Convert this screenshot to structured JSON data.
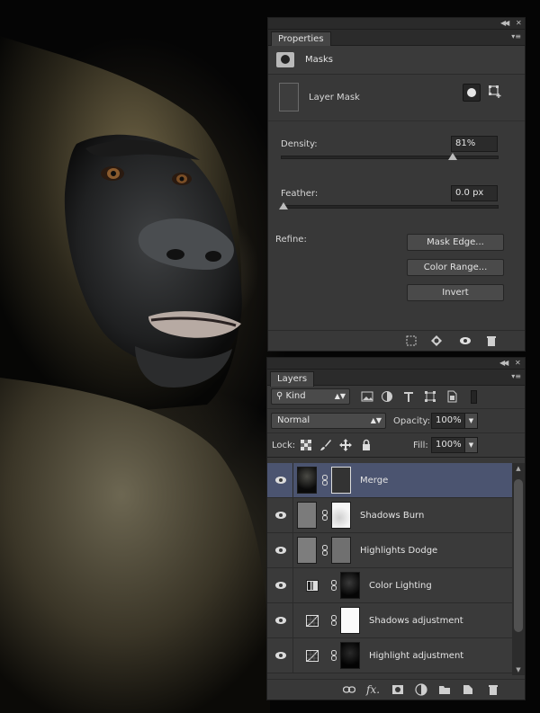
{
  "properties_panel": {
    "tab_label": "Properties",
    "section_title": "Masks",
    "layer_mask_label": "Layer Mask",
    "density": {
      "label": "Density:",
      "value": "81%",
      "percent": 81
    },
    "feather": {
      "label": "Feather:",
      "value": "0.0 px",
      "percent": 0
    },
    "refine_label": "Refine:",
    "buttons": {
      "mask_edge": "Mask Edge...",
      "color_range": "Color Range...",
      "invert": "Invert"
    }
  },
  "layers_panel": {
    "tab_label": "Layers",
    "filter": {
      "kind_label": "Kind"
    },
    "blend_mode": "Normal",
    "opacity": {
      "label": "Opacity:",
      "value": "100%"
    },
    "lock_label": "Lock:",
    "fill": {
      "label": "Fill:",
      "value": "100%"
    },
    "layers": [
      {
        "name": "Merge",
        "selected": true,
        "type": "pixel"
      },
      {
        "name": "Shadows Burn",
        "selected": false,
        "type": "pixel"
      },
      {
        "name": "Highlights Dodge",
        "selected": false,
        "type": "pixel"
      },
      {
        "name": "Color Lighting",
        "selected": false,
        "type": "adjustment-gradient"
      },
      {
        "name": "Shadows adjustment",
        "selected": false,
        "type": "adjustment-curves"
      },
      {
        "name": "Highlight adjustment",
        "selected": false,
        "type": "adjustment-curves"
      }
    ]
  },
  "colors": {
    "panel_bg": "#383838",
    "selected_row": "#4b5470",
    "canvas_bg": "#000000"
  }
}
